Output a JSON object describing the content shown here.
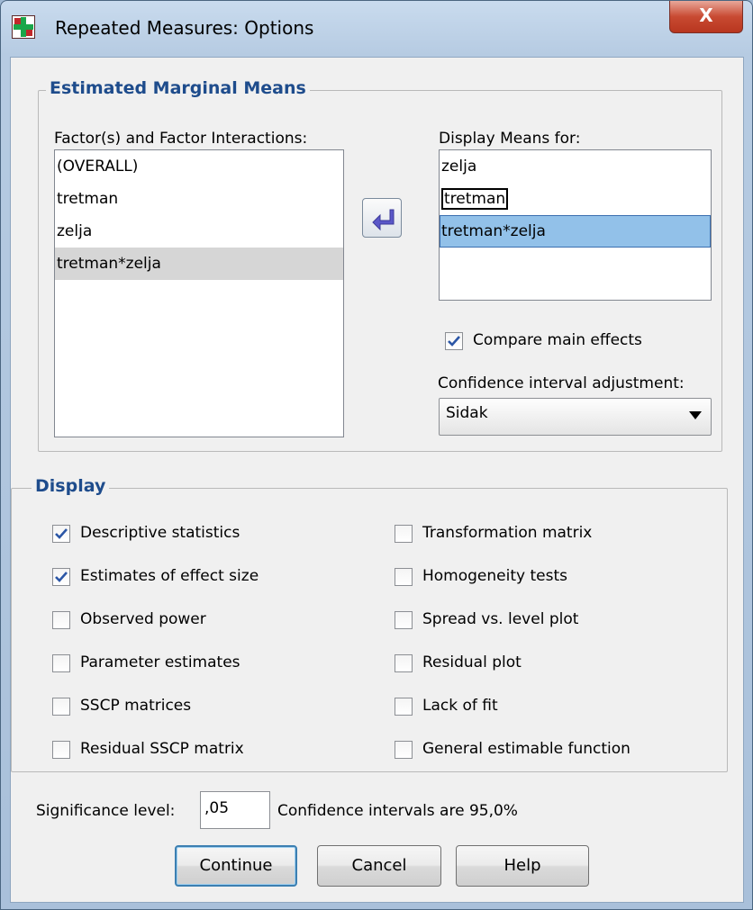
{
  "window": {
    "title": "Repeated Measures: Options",
    "close_glyph": "X"
  },
  "emm": {
    "group_title": "Estimated Marginal Means",
    "factors_label": "Factor(s) and Factor Interactions:",
    "factors": [
      "(OVERALL)",
      "tretman",
      "zelja",
      "tretman*zelja"
    ],
    "display_label": "Display Means for:",
    "display_means": [
      "zelja",
      "tretman",
      "tretman*zelja"
    ],
    "compare_main_effects": {
      "label": "Compare main effects",
      "checked": true
    },
    "ci_adjust_label": "Confidence interval adjustment:",
    "ci_adjust_value": "Sidak",
    "move_icon": "arrow-left-icon"
  },
  "display": {
    "group_title": "Display",
    "left": [
      {
        "label": "Descriptive statistics",
        "checked": true
      },
      {
        "label": "Estimates of effect size",
        "checked": true
      },
      {
        "label": "Observed power",
        "checked": false
      },
      {
        "label": "Parameter estimates",
        "checked": false
      },
      {
        "label": "SSCP matrices",
        "checked": false
      },
      {
        "label": "Residual SSCP matrix",
        "checked": false
      }
    ],
    "right": [
      {
        "label": "Transformation matrix",
        "checked": false
      },
      {
        "label": "Homogeneity tests",
        "checked": false
      },
      {
        "label": "Spread vs. level plot",
        "checked": false
      },
      {
        "label": "Residual plot",
        "checked": false
      },
      {
        "label": "Lack of fit",
        "checked": false
      },
      {
        "label": "General estimable function",
        "checked": false
      }
    ]
  },
  "significance": {
    "label": "Significance level:",
    "value": ",05",
    "ci_text": "Confidence intervals are 95,0%"
  },
  "buttons": {
    "continue": "Continue",
    "cancel": "Cancel",
    "help": "Help"
  },
  "colors": {
    "group_title": "#1e4c8c",
    "selection": "#92c1e9",
    "checkmark": "#2b56a6",
    "arrow": "#5a57c8"
  }
}
